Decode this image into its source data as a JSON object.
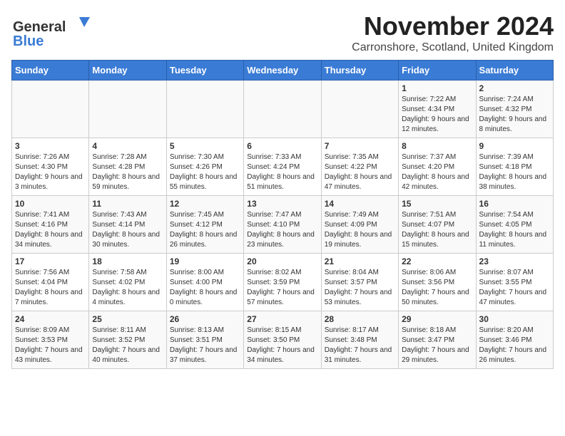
{
  "header": {
    "logo_general": "General",
    "logo_blue": "Blue",
    "title": "November 2024",
    "location": "Carronshore, Scotland, United Kingdom"
  },
  "weekdays": [
    "Sunday",
    "Monday",
    "Tuesday",
    "Wednesday",
    "Thursday",
    "Friday",
    "Saturday"
  ],
  "weeks": [
    [
      {
        "day": "",
        "sunrise": "",
        "sunset": "",
        "daylight": ""
      },
      {
        "day": "",
        "sunrise": "",
        "sunset": "",
        "daylight": ""
      },
      {
        "day": "",
        "sunrise": "",
        "sunset": "",
        "daylight": ""
      },
      {
        "day": "",
        "sunrise": "",
        "sunset": "",
        "daylight": ""
      },
      {
        "day": "",
        "sunrise": "",
        "sunset": "",
        "daylight": ""
      },
      {
        "day": "1",
        "sunrise": "Sunrise: 7:22 AM",
        "sunset": "Sunset: 4:34 PM",
        "daylight": "Daylight: 9 hours and 12 minutes."
      },
      {
        "day": "2",
        "sunrise": "Sunrise: 7:24 AM",
        "sunset": "Sunset: 4:32 PM",
        "daylight": "Daylight: 9 hours and 8 minutes."
      }
    ],
    [
      {
        "day": "3",
        "sunrise": "Sunrise: 7:26 AM",
        "sunset": "Sunset: 4:30 PM",
        "daylight": "Daylight: 9 hours and 3 minutes."
      },
      {
        "day": "4",
        "sunrise": "Sunrise: 7:28 AM",
        "sunset": "Sunset: 4:28 PM",
        "daylight": "Daylight: 8 hours and 59 minutes."
      },
      {
        "day": "5",
        "sunrise": "Sunrise: 7:30 AM",
        "sunset": "Sunset: 4:26 PM",
        "daylight": "Daylight: 8 hours and 55 minutes."
      },
      {
        "day": "6",
        "sunrise": "Sunrise: 7:33 AM",
        "sunset": "Sunset: 4:24 PM",
        "daylight": "Daylight: 8 hours and 51 minutes."
      },
      {
        "day": "7",
        "sunrise": "Sunrise: 7:35 AM",
        "sunset": "Sunset: 4:22 PM",
        "daylight": "Daylight: 8 hours and 47 minutes."
      },
      {
        "day": "8",
        "sunrise": "Sunrise: 7:37 AM",
        "sunset": "Sunset: 4:20 PM",
        "daylight": "Daylight: 8 hours and 42 minutes."
      },
      {
        "day": "9",
        "sunrise": "Sunrise: 7:39 AM",
        "sunset": "Sunset: 4:18 PM",
        "daylight": "Daylight: 8 hours and 38 minutes."
      }
    ],
    [
      {
        "day": "10",
        "sunrise": "Sunrise: 7:41 AM",
        "sunset": "Sunset: 4:16 PM",
        "daylight": "Daylight: 8 hours and 34 minutes."
      },
      {
        "day": "11",
        "sunrise": "Sunrise: 7:43 AM",
        "sunset": "Sunset: 4:14 PM",
        "daylight": "Daylight: 8 hours and 30 minutes."
      },
      {
        "day": "12",
        "sunrise": "Sunrise: 7:45 AM",
        "sunset": "Sunset: 4:12 PM",
        "daylight": "Daylight: 8 hours and 26 minutes."
      },
      {
        "day": "13",
        "sunrise": "Sunrise: 7:47 AM",
        "sunset": "Sunset: 4:10 PM",
        "daylight": "Daylight: 8 hours and 23 minutes."
      },
      {
        "day": "14",
        "sunrise": "Sunrise: 7:49 AM",
        "sunset": "Sunset: 4:09 PM",
        "daylight": "Daylight: 8 hours and 19 minutes."
      },
      {
        "day": "15",
        "sunrise": "Sunrise: 7:51 AM",
        "sunset": "Sunset: 4:07 PM",
        "daylight": "Daylight: 8 hours and 15 minutes."
      },
      {
        "day": "16",
        "sunrise": "Sunrise: 7:54 AM",
        "sunset": "Sunset: 4:05 PM",
        "daylight": "Daylight: 8 hours and 11 minutes."
      }
    ],
    [
      {
        "day": "17",
        "sunrise": "Sunrise: 7:56 AM",
        "sunset": "Sunset: 4:04 PM",
        "daylight": "Daylight: 8 hours and 7 minutes."
      },
      {
        "day": "18",
        "sunrise": "Sunrise: 7:58 AM",
        "sunset": "Sunset: 4:02 PM",
        "daylight": "Daylight: 8 hours and 4 minutes."
      },
      {
        "day": "19",
        "sunrise": "Sunrise: 8:00 AM",
        "sunset": "Sunset: 4:00 PM",
        "daylight": "Daylight: 8 hours and 0 minutes."
      },
      {
        "day": "20",
        "sunrise": "Sunrise: 8:02 AM",
        "sunset": "Sunset: 3:59 PM",
        "daylight": "Daylight: 7 hours and 57 minutes."
      },
      {
        "day": "21",
        "sunrise": "Sunrise: 8:04 AM",
        "sunset": "Sunset: 3:57 PM",
        "daylight": "Daylight: 7 hours and 53 minutes."
      },
      {
        "day": "22",
        "sunrise": "Sunrise: 8:06 AM",
        "sunset": "Sunset: 3:56 PM",
        "daylight": "Daylight: 7 hours and 50 minutes."
      },
      {
        "day": "23",
        "sunrise": "Sunrise: 8:07 AM",
        "sunset": "Sunset: 3:55 PM",
        "daylight": "Daylight: 7 hours and 47 minutes."
      }
    ],
    [
      {
        "day": "24",
        "sunrise": "Sunrise: 8:09 AM",
        "sunset": "Sunset: 3:53 PM",
        "daylight": "Daylight: 7 hours and 43 minutes."
      },
      {
        "day": "25",
        "sunrise": "Sunrise: 8:11 AM",
        "sunset": "Sunset: 3:52 PM",
        "daylight": "Daylight: 7 hours and 40 minutes."
      },
      {
        "day": "26",
        "sunrise": "Sunrise: 8:13 AM",
        "sunset": "Sunset: 3:51 PM",
        "daylight": "Daylight: 7 hours and 37 minutes."
      },
      {
        "day": "27",
        "sunrise": "Sunrise: 8:15 AM",
        "sunset": "Sunset: 3:50 PM",
        "daylight": "Daylight: 7 hours and 34 minutes."
      },
      {
        "day": "28",
        "sunrise": "Sunrise: 8:17 AM",
        "sunset": "Sunset: 3:48 PM",
        "daylight": "Daylight: 7 hours and 31 minutes."
      },
      {
        "day": "29",
        "sunrise": "Sunrise: 8:18 AM",
        "sunset": "Sunset: 3:47 PM",
        "daylight": "Daylight: 7 hours and 29 minutes."
      },
      {
        "day": "30",
        "sunrise": "Sunrise: 8:20 AM",
        "sunset": "Sunset: 3:46 PM",
        "daylight": "Daylight: 7 hours and 26 minutes."
      }
    ]
  ]
}
